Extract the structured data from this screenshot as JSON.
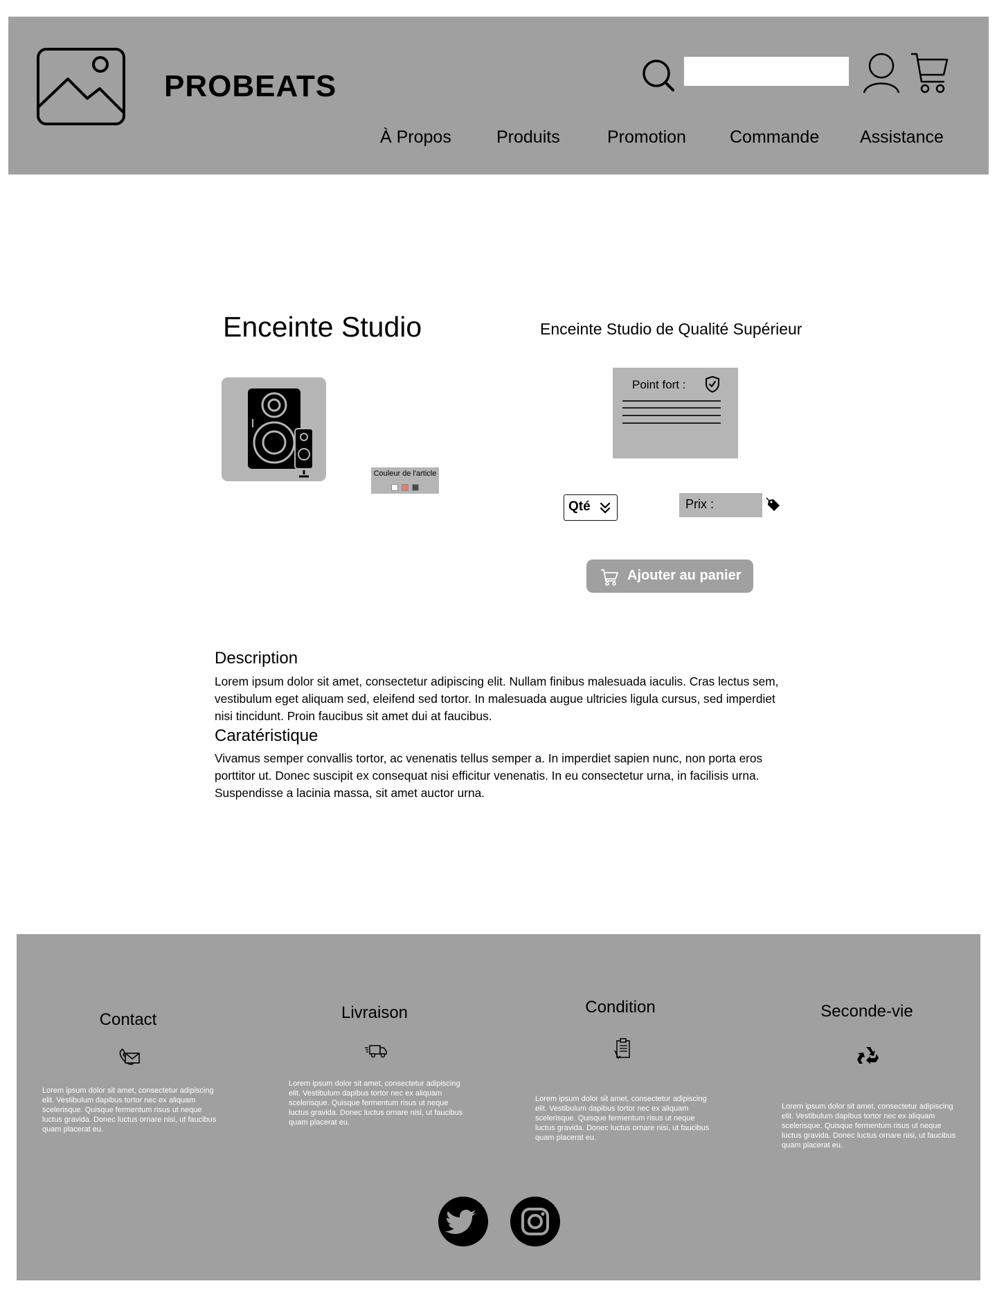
{
  "header": {
    "brand": "PROBEATS",
    "search": {
      "value": "",
      "placeholder": ""
    },
    "nav": [
      "À Propos",
      "Produits",
      "Promotion",
      "Commande",
      "Assistance"
    ]
  },
  "product": {
    "title": "Enceinte Studio",
    "subtitle": "Enceinte Studio de Qualité Supérieur",
    "color_label": "Couleur de l'article",
    "swatch_colors": [
      "#ffffff",
      "#e87a7a",
      "#4a4a4a"
    ],
    "highlight_label": "Point fort :",
    "qty_label": "Qté",
    "price_label": "Prix :",
    "add_to_cart": "Ajouter au panier"
  },
  "description": {
    "heading": "Description",
    "text": "Lorem ipsum dolor sit amet, consectetur adipiscing elit. Nullam finibus malesuada iaculis. Cras lectus sem, vestibulum eget aliquam sed, eleifend sed tortor. In malesuada augue ultricies ligula cursus, sed imperdiet nisi tincidunt. Proin faucibus sit amet dui at faucibus."
  },
  "characteristics": {
    "heading": "Caratéristique",
    "text": "Vivamus semper convallis tortor, ac venenatis tellus semper a. In imperdiet sapien nunc, non porta eros porttitor ut. Donec suscipit ex consequat nisi efficitur venenatis. In eu consectetur urna, in facilisis urna. Suspendisse a lacinia massa, sit amet auctor urna."
  },
  "footer": {
    "columns": [
      {
        "title": "Contact",
        "icon": "phone-mail-icon",
        "text": "Lorem ipsum dolor sit amet, consectetur adipiscing elit. Vestibulum dapibus tortor nec ex aliquam scelerisque. Quisque fermentum risus ut neque luctus gravida. Donec luctus ornare nisi, ut faucibus quam placerat eu."
      },
      {
        "title": "Livraison",
        "icon": "delivery-truck-icon",
        "text": "Lorem ipsum dolor sit amet, consectetur adipiscing elit. Vestibulum dapibus tortor nec ex aliquam scelerisque. Quisque fermentum risus ut neque luctus gravida. Donec luctus ornare nisi, ut faucibus quam placerat eu."
      },
      {
        "title": "Condition",
        "icon": "clipboard-icon",
        "text": "Lorem ipsum dolor sit amet, consectetur adipiscing elit. Vestibulum dapibus tortor nec ex aliquam scelerisque. Quisque fermentum risus ut neque luctus gravida. Donec luctus ornare nisi, ut faucibus quam placerat eu."
      },
      {
        "title": "Seconde-vie",
        "icon": "recycle-icon",
        "text": "Lorem ipsum dolor sit amet, consectetur adipiscing elit. Vestibulum dapibus tortor nec ex aliquam scelerisque. Quisque fermentum risus ut neque luctus gravida. Donec luctus ornare nisi, ut faucibus quam placerat eu."
      }
    ],
    "social": [
      "twitter-icon",
      "instagram-icon"
    ]
  },
  "colors": {
    "panel": "#a0a0a0",
    "box": "#b5b5b5",
    "page": "#ffffff"
  }
}
